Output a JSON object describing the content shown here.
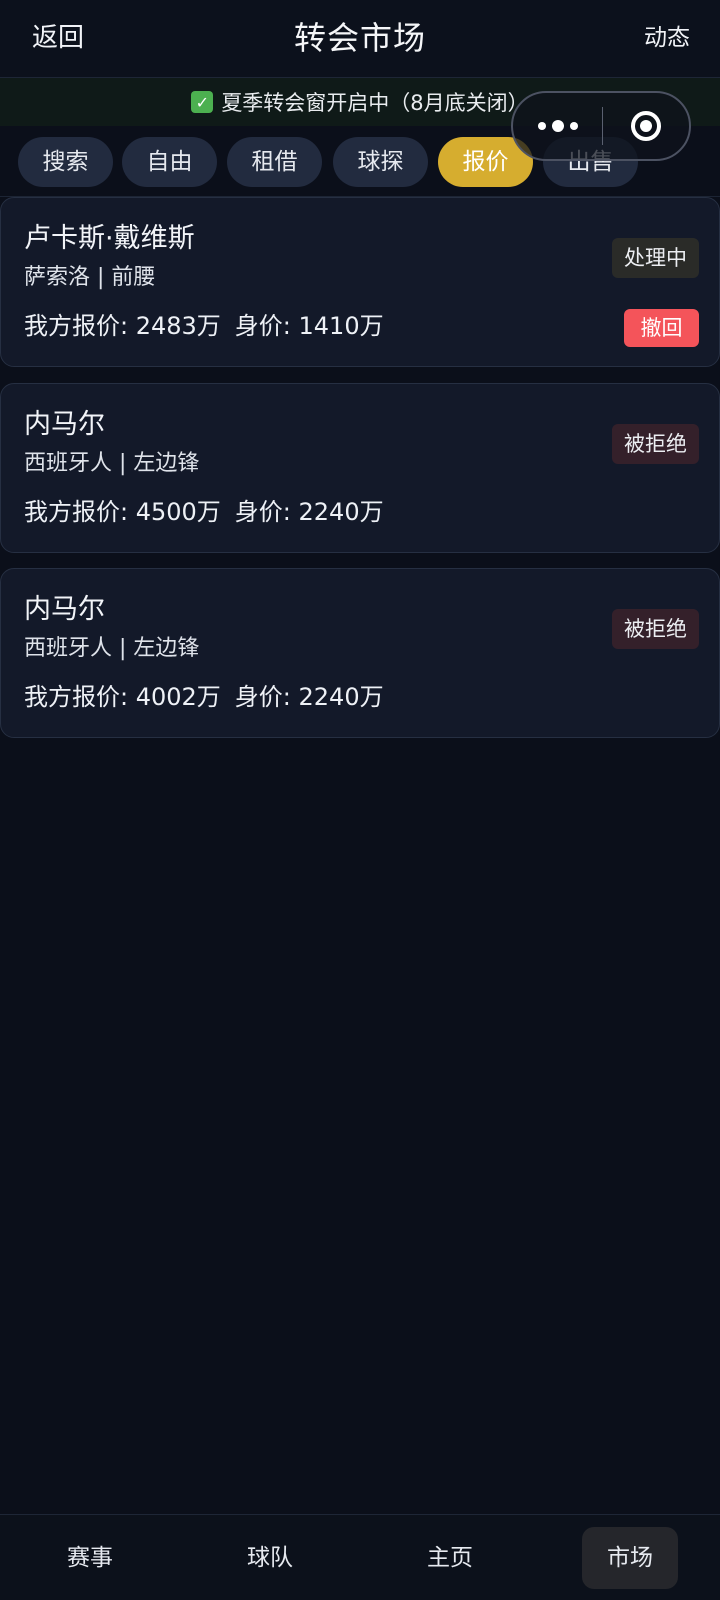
{
  "header": {
    "back_label": "返回",
    "title": "转会市场",
    "activity_label": "动态"
  },
  "notice": {
    "icon": "check-mark-icon",
    "text": "夏季转会窗开启中（8月底关闭）"
  },
  "capsule": {
    "more_icon": "more-dots-icon",
    "close_icon": "target-close-icon"
  },
  "tabs": [
    {
      "label": "搜索"
    },
    {
      "label": "自由"
    },
    {
      "label": "租借"
    },
    {
      "label": "球探"
    },
    {
      "label": "报价",
      "active": true
    },
    {
      "label": "出售"
    }
  ],
  "offers": [
    {
      "name": "卢卡斯·戴维斯",
      "sub": "萨索洛 | 前腰",
      "offer": "我方报价: 2483万",
      "value": "身价: 1410万",
      "status": "处理中",
      "action": "撤回"
    },
    {
      "name": "内马尔",
      "sub": "西班牙人 | 左边锋",
      "offer": "我方报价: 4500万",
      "value": "身价: 2240万",
      "status": "被拒绝"
    },
    {
      "name": "内马尔",
      "sub": "西班牙人 | 左边锋",
      "offer": "我方报价: 4002万",
      "value": "身价: 2240万",
      "status": "被拒绝"
    }
  ],
  "bottom_nav": [
    {
      "label": "赛事"
    },
    {
      "label": "球队"
    },
    {
      "label": "主页"
    },
    {
      "label": "市场",
      "active": true
    }
  ],
  "colors": {
    "background": "#0b0f1a",
    "card": "#131929",
    "tab": "#222b3f",
    "tab_active": "#d6ad2f",
    "withdraw": "#f4545a",
    "badge_processing": "#2a2b28",
    "badge_rejected": "#34202a"
  }
}
